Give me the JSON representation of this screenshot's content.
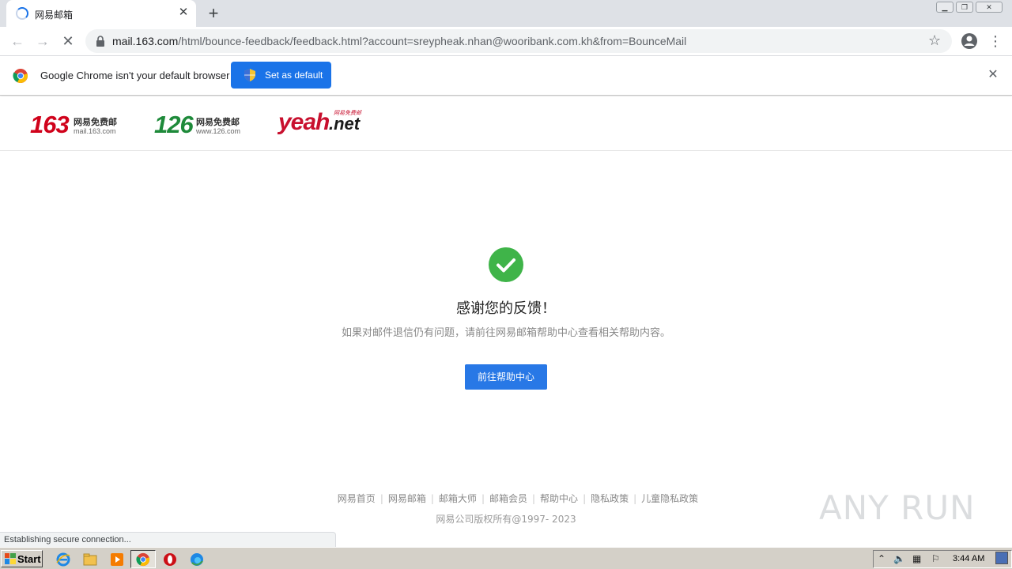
{
  "browser": {
    "tab_title": "网易邮箱",
    "url_host": "mail.163.com",
    "url_path": "/html/bounce-feedback/feedback.html?account=sreypheak.nhan@wooribank.com.kh&from=BounceMail",
    "infobar_text": "Google Chrome isn't your default browser",
    "set_default_label": "Set as default",
    "status_text": "Establishing secure connection..."
  },
  "header": {
    "logo_163": {
      "number": "163",
      "cn": "网易免费邮",
      "url": "mail.163.com"
    },
    "logo_126": {
      "number": "126",
      "cn": "网易免费邮",
      "url": "www.126.com"
    },
    "logo_yeah": {
      "main": "yeah",
      "suffix": ".net",
      "cn": "网易免费邮"
    }
  },
  "main": {
    "title": "感谢您的反馈！",
    "description": "如果对邮件退信仍有问题，请前往网易邮箱帮助中心查看相关帮助内容。",
    "button_label": "前往帮助中心"
  },
  "footer": {
    "links": [
      "网易首页",
      "网易邮箱",
      "邮箱大师",
      "邮箱会员",
      "帮助中心",
      "隐私政策",
      "儿童隐私政策"
    ],
    "separator": "|",
    "copyright": "网易公司版权所有@1997- 2023"
  },
  "watermark": "ANY RUN",
  "taskbar": {
    "start_label": "Start",
    "clock": "3:44 AM"
  },
  "colors": {
    "accent_blue": "#1a73e8",
    "help_button": "#2878e6",
    "success_green": "#3fb449",
    "brand_163_red": "#d0021b",
    "brand_126_green": "#1e8a3a",
    "brand_yeah_red": "#c8102e"
  }
}
